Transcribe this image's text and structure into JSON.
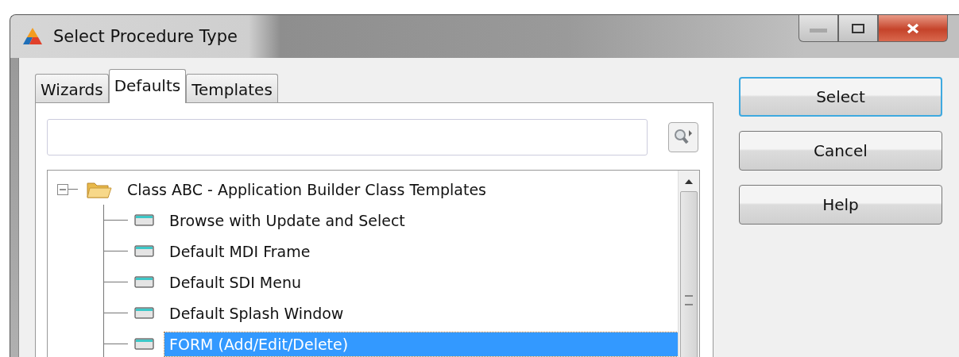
{
  "window": {
    "title": "Select Procedure Type"
  },
  "tabs": [
    {
      "label": "Wizards",
      "selected": false
    },
    {
      "label": "Defaults",
      "selected": true
    },
    {
      "label": "Templates",
      "selected": false
    }
  ],
  "tree": [
    {
      "label": "Class ABC - Application Builder Class Templates",
      "expanded": true,
      "selected": false,
      "children": [
        {
          "label": "Browse with Update and Select",
          "selected": false
        },
        {
          "label": "Default MDI Frame",
          "selected": false
        },
        {
          "label": "Default SDI Menu",
          "selected": false
        },
        {
          "label": "Default Splash Window",
          "selected": false
        },
        {
          "label": "FORM (Add/Edit/Delete)",
          "selected": true
        }
      ]
    }
  ],
  "buttons": [
    {
      "label": "Select",
      "selected": true
    },
    {
      "label": "Cancel",
      "selected": false
    },
    {
      "label": "Help",
      "selected": false
    }
  ]
}
